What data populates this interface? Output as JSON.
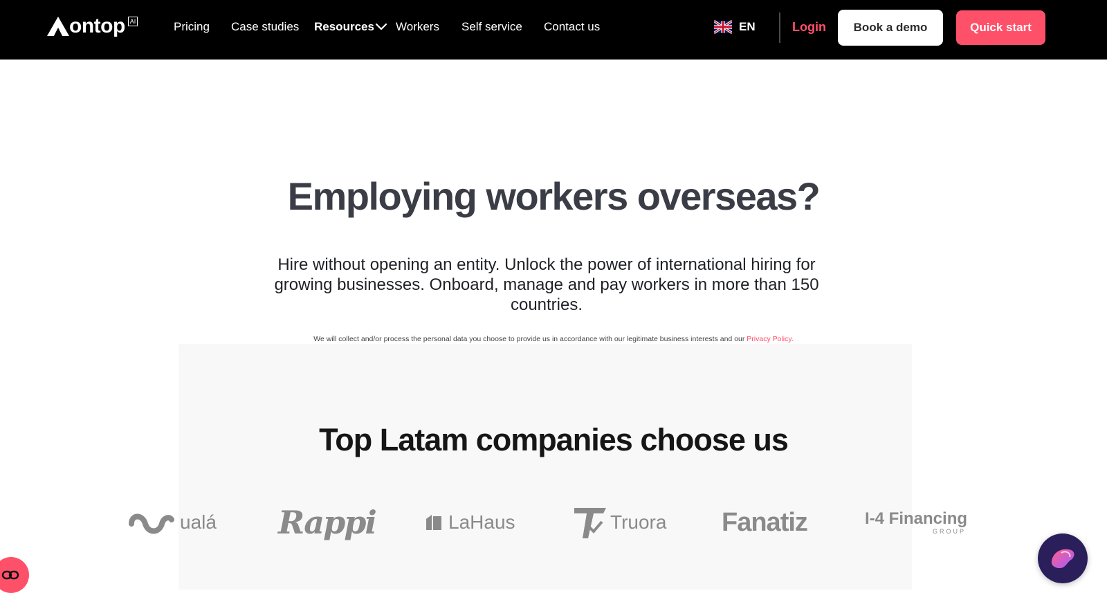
{
  "header": {
    "logo_text": "ontop",
    "logo_badge": "AI",
    "nav": {
      "pricing": "Pricing",
      "case_studies": "Case studies",
      "resources": "Resources",
      "workers": "Workers",
      "self_service": "Self service",
      "contact": "Contact us"
    },
    "language": "EN",
    "login": "Login",
    "book_demo": "Book a demo",
    "quick_start": "Quick start"
  },
  "hero": {
    "title": "Employing workers overseas?",
    "subtitle": "Hire without opening an entity. Unlock the power of international hiring for growing businesses. Onboard, manage and pay workers in more than 150 countries.",
    "privacy_text": "We will collect and/or process the personal data you choose to provide us in accordance with our legitimate business interests and our ",
    "privacy_link": "Privacy Policy."
  },
  "companies": {
    "title": "Top Latam companies choose us",
    "logos": {
      "uala": "ualá",
      "rappi": "Rappi",
      "lahaus": "LaHaus",
      "truora": "Truora",
      "fanatiz": "Fanatiz",
      "i4": "I-4 Financing",
      "i4_group": "GROUP"
    }
  },
  "colors": {
    "brand_pink": "#ff5069",
    "nav_bg": "#000000",
    "section_bg": "#f8f8f8",
    "chat_bg": "#2a1f5a"
  },
  "icons": [
    "ontop-logo-icon",
    "chevron-down-icon",
    "uk-flag-icon",
    "cookie-settings-icon",
    "chat-assistant-icon"
  ]
}
